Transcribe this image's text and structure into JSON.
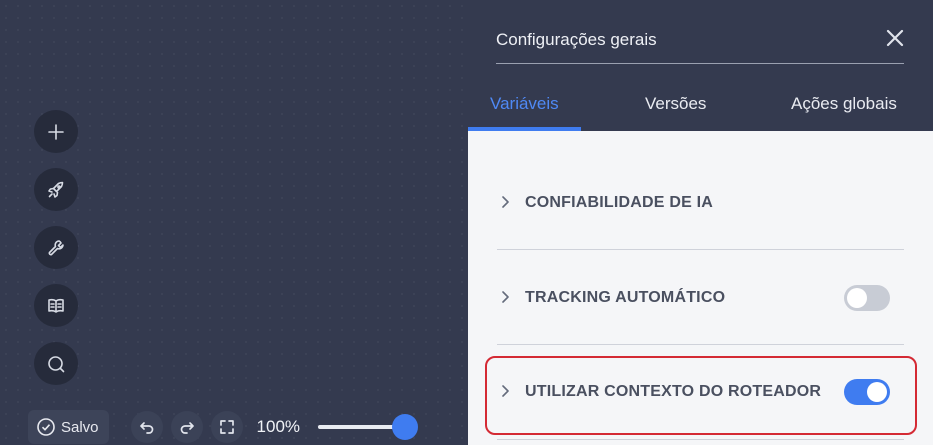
{
  "panel": {
    "title": "Configurações gerais",
    "close_icon": "close-icon",
    "tabs": [
      {
        "label": "Variáveis",
        "active": true
      },
      {
        "label": "Versões",
        "active": false
      },
      {
        "label": "Ações globais",
        "active": false
      }
    ],
    "sections": [
      {
        "label": "CONFIABILIDADE DE IA",
        "has_toggle": false
      },
      {
        "label": "TRACKING AUTOMÁTICO",
        "has_toggle": true,
        "toggle_on": false
      },
      {
        "label": "UTILIZAR CONTEXTO DO ROTEADOR",
        "has_toggle": true,
        "toggle_on": true,
        "highlighted": true
      }
    ]
  },
  "toolbar": {
    "buttons": [
      {
        "icon": "plus-icon"
      },
      {
        "icon": "rocket-icon"
      },
      {
        "icon": "wrench-icon"
      },
      {
        "icon": "book-icon"
      },
      {
        "icon": "search-icon"
      }
    ]
  },
  "bottom_bar": {
    "saved_label": "Salvo",
    "saved_icon": "check-circle-icon",
    "undo_icon": "undo-icon",
    "redo_icon": "redo-icon",
    "fullscreen_icon": "fullscreen-icon",
    "zoom_label": "100%",
    "zoom_fraction": 1.0
  },
  "colors": {
    "canvas": "#343a4f",
    "accent": "#3f7cf0",
    "highlight": "#d42a34",
    "panel_body": "#f5f6f8"
  }
}
